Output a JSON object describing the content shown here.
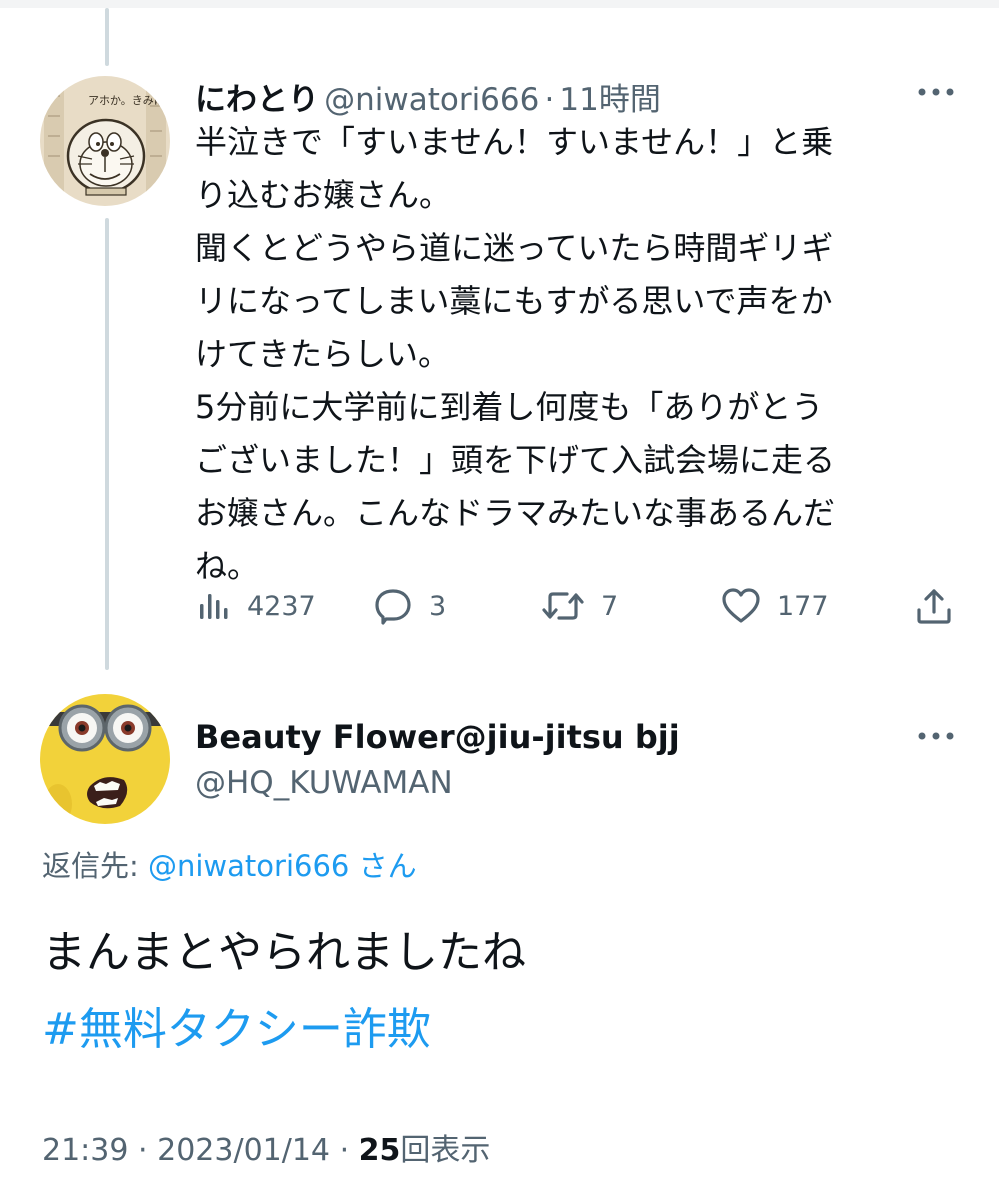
{
  "tweet1": {
    "display_name": "にわとり",
    "handle": "@niwatori666",
    "separator": "·",
    "time": "11時間",
    "avatar_text": "アホか。きみは。",
    "text_lines": [
      "半泣きで「すいません！すいません！」と乗",
      "り込むお嬢さん。",
      "聞くとどうやら道に迷っていたら時間ギリギ",
      "リになってしまい藁にもすがる思いで声をか",
      "けてきたらしい。",
      "5分前に大学前に到着し何度も「ありがとう",
      "ございました！」頭を下げて入試会場に走る",
      "お嬢さん。こんなドラマみたいな事あるんだ",
      "ね。"
    ],
    "actions": {
      "views": "4237",
      "replies": "3",
      "retweets": "7",
      "likes": "177"
    }
  },
  "tweet2": {
    "display_name": "Beauty Flower@jiu-jitsu bjj",
    "handle": "@HQ_KUWAMAN",
    "reply_to_label": "返信先: ",
    "reply_to_handle": "@niwatori666",
    "reply_to_suffix": "さん",
    "text": "まんまとやられましたね",
    "hashtag": "#無料タクシー詐欺",
    "time": "21:39",
    "separator": "·",
    "date": "2023/01/14",
    "views_count": "25",
    "views_label": "回表示"
  },
  "colors": {
    "text_primary": "#0f1419",
    "text_secondary": "#536471",
    "accent": "#1d9bf0",
    "thread_line": "#cfd9de"
  },
  "icons": {
    "views": "bar-chart-icon",
    "reply": "speech-bubble-icon",
    "retweet": "retweet-icon",
    "like": "heart-icon",
    "share": "share-icon",
    "more": "more-dots-icon"
  }
}
